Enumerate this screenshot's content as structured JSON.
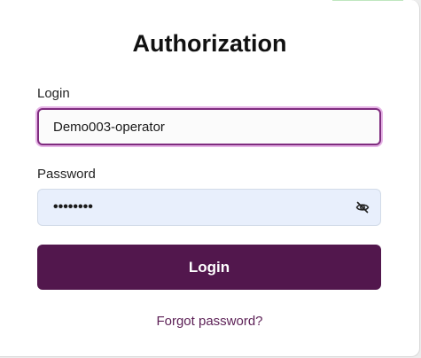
{
  "form": {
    "title": "Authorization",
    "login": {
      "label": "Login",
      "value": "Demo003-operator"
    },
    "password": {
      "label": "Password",
      "masked_value": "••••••••",
      "toggle_icon": "eye-slash-icon"
    },
    "submit_label": "Login",
    "forgot_password_label": "Forgot password?"
  },
  "colors": {
    "primary": "#52174d",
    "focus_border": "#7f2c7f",
    "focus_glow": "#e6b3e6",
    "password_bg": "#e8effc",
    "link": "#5b1f55"
  }
}
